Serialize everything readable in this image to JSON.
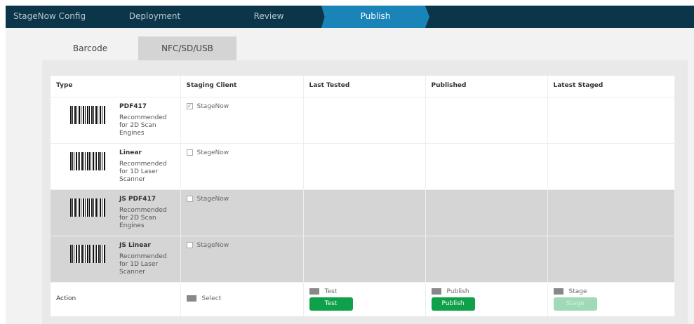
{
  "steps": [
    "StageNow Config",
    "Deployment",
    "Review",
    "Publish"
  ],
  "tabs": [
    "Barcode",
    "NFC/SD/USB"
  ],
  "columns": [
    "Type",
    "Staging Client",
    "Last Tested",
    "Published",
    "Latest Staged"
  ],
  "rows": [
    {
      "name": "PDF417",
      "desc": "Recommended for 2D Scan Engines",
      "client": "StageNow",
      "checked": true
    },
    {
      "name": "Linear",
      "desc": "Recommended for 1D Laser Scanner",
      "client": "StageNow",
      "checked": false
    },
    {
      "name": "JS PDF417",
      "desc": "Recommended for 2D Scan Engines",
      "client": "StageNow",
      "checked": false
    },
    {
      "name": "JS Linear",
      "desc": "Recommended for 1D Laser Scanner",
      "client": "StageNow",
      "checked": false
    }
  ],
  "action": {
    "label": "Action",
    "select": "Select",
    "test_label": "Test",
    "test_btn": "Test",
    "publish_label": "Publish",
    "publish_btn": "Publish",
    "stage_label": "Stage",
    "stage_btn": "Stage"
  }
}
